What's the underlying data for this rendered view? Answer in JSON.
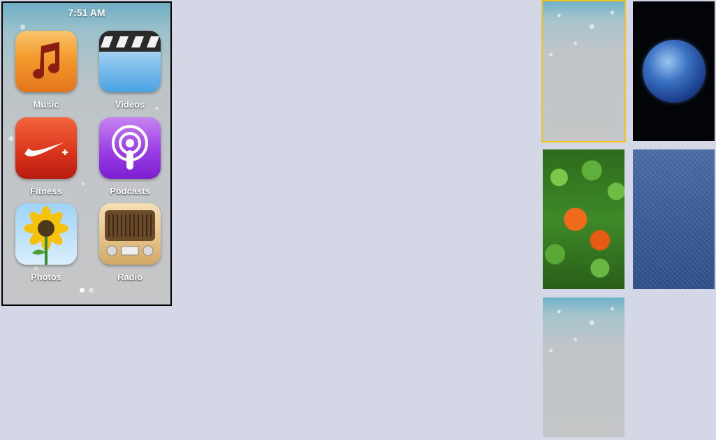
{
  "status_bar": {
    "time": "7:51 AM"
  },
  "apps": [
    {
      "label": "Music",
      "icon": "music-note-icon"
    },
    {
      "label": "Videos",
      "icon": "clapperboard-icon"
    },
    {
      "label": "Fitness",
      "icon": "nike-swoosh-icon"
    },
    {
      "label": "Podcasts",
      "icon": "podcast-icon"
    },
    {
      "label": "Photos",
      "icon": "sunflower-icon"
    },
    {
      "label": "Radio",
      "icon": "radio-icon"
    }
  ],
  "page_indicator": {
    "pages": 2,
    "current": 1
  },
  "wallpapers": [
    {
      "name": "water-drops",
      "selected": true
    },
    {
      "name": "earth",
      "selected": false
    },
    {
      "name": "clownfish",
      "selected": false
    },
    {
      "name": "denim",
      "selected": false
    },
    {
      "name": "water-drops",
      "selected": false
    }
  ],
  "colors": {
    "background": "#d4d7e6",
    "selection": "#f3c31a"
  }
}
